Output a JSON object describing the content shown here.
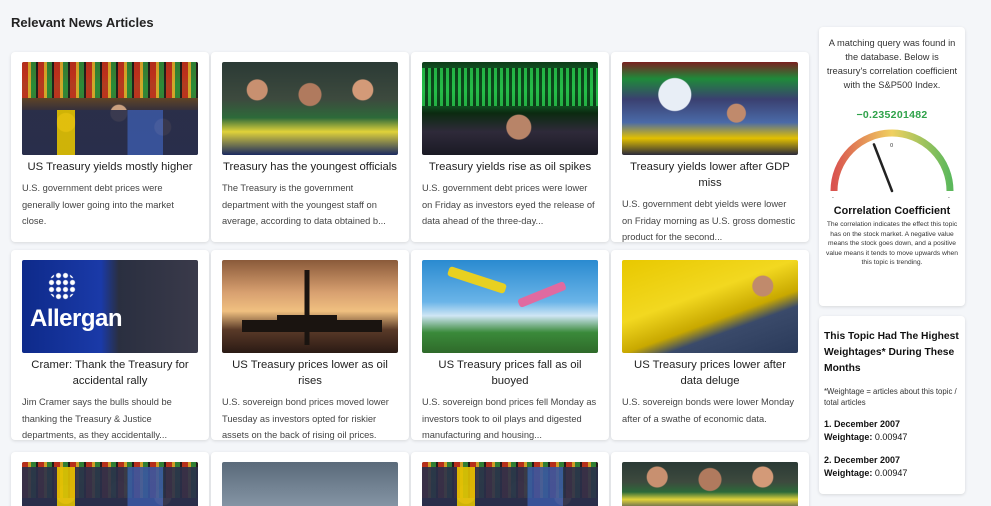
{
  "section_title": "Relevant News Articles",
  "articles": [
    {
      "image": "trading-floor-photo",
      "title": "US Treasury yields mostly higher",
      "desc": "U.S. government debt prices were generally lower going into the market close."
    },
    {
      "image": "traders-crowd-photo",
      "title": "Treasury has the youngest officials",
      "desc": "The Treasury is the government department with the youngest staff on average, according to data obtained b..."
    },
    {
      "image": "ticker-board-photo",
      "title": "Treasury yields rise as oil spikes",
      "desc": "U.S. government debt prices were lower on Friday as investors eyed the release of data ahead of the three-day..."
    },
    {
      "image": "exchange-floor-photo",
      "title": "Treasury yields lower after GDP miss",
      "desc": "U.S. government debt yields were lower on Friday morning as U.S. gross domestic product for the second..."
    },
    {
      "image": "allergan-floor-photo",
      "title": "Cramer: Thank the Treasury for accidental rally",
      "desc": "Jim Cramer says the bulls should be thanking the Treasury & Justice departments, as they accidentally..."
    },
    {
      "image": "oil-rig-photo",
      "title": "US Treasury prices lower as oil rises",
      "desc": "U.S. sovereign bond prices moved lower Tuesday as investors opted for riskier assets on the back of rising oil prices."
    },
    {
      "image": "oil-pumps-photo",
      "title": "US Treasury prices fall as oil buoyed",
      "desc": "U.S. sovereign bond prices fell Monday as investors took to oil plays and digested manufacturing and housing..."
    },
    {
      "image": "worker-machine-photo",
      "title": "US Treasury prices lower after data deluge",
      "desc": "U.S. sovereign bonds were lower Monday after of a swathe of economic data."
    }
  ],
  "partial_row": [
    "trading-floor-photo",
    "grey-photo",
    "trading-floor-photo",
    "traders-crowd-photo"
  ],
  "correlation": {
    "intro": "A matching query was found in the database. Below is treasury's correlation coefficient with the S&P500 Index.",
    "value": "−0.235201482",
    "value_numeric": -0.235201482,
    "gauge_min_label": "-",
    "gauge_mid_label": "0",
    "gauge_max_label": "-",
    "title": "Correlation Coefficient",
    "description": "The correlation indicates the effect this topic has on the stock market. A negative value means the stock goes down, and a positive value means it tends to move upwards when this topic is trending.",
    "colors": {
      "negative": "#d9534f",
      "positive": "#5cb85c",
      "value": "#2fa24a"
    }
  },
  "weightage": {
    "title": "This Topic Had The Highest Weightages* During These Months",
    "note": "*Weightage = articles about this topic / total articles",
    "items": [
      {
        "label": "1. December 2007",
        "weight_label": "Weightage:",
        "weight": "0.00947"
      },
      {
        "label": "2. December 2007",
        "weight_label": "Weightage:",
        "weight": "0.00947"
      }
    ]
  }
}
